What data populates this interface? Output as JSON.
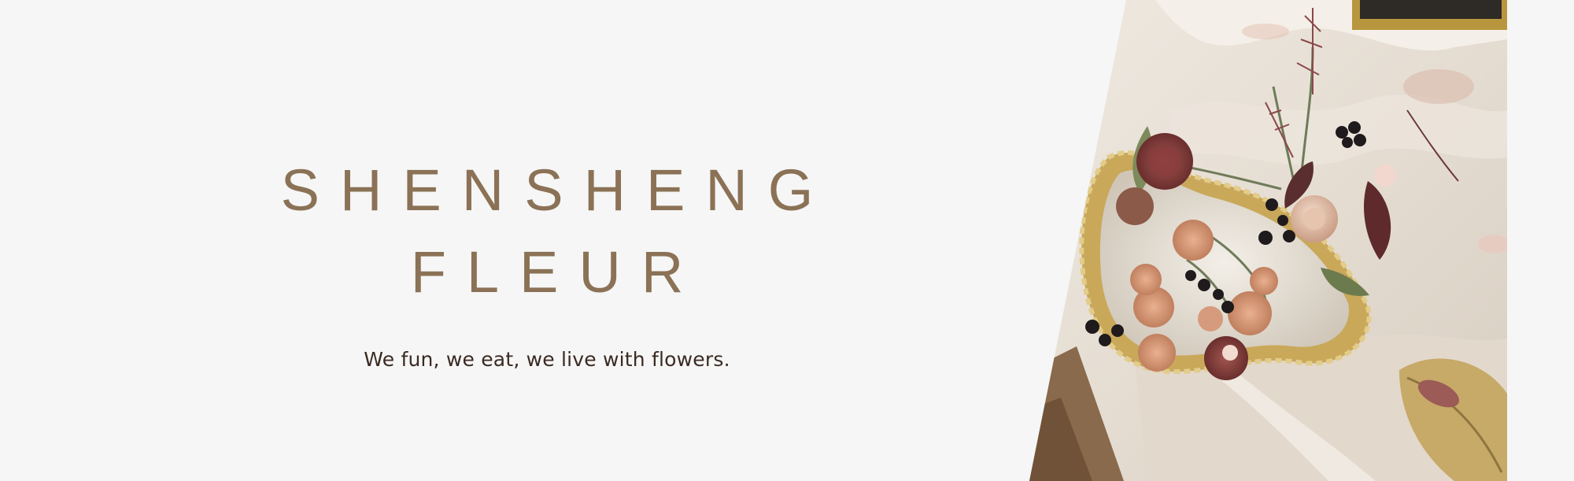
{
  "hero": {
    "title_line1": "SHENSHENG",
    "title_line2": "FLEUR",
    "tagline": "We fun, we eat, we live with flowers.",
    "title_color": "#8b7256",
    "background_color": "#f6f6f6",
    "photo": {
      "icon": "floral-arrangement-photo",
      "subject": "dried flower arrangement on gilded mirror tray"
    }
  }
}
